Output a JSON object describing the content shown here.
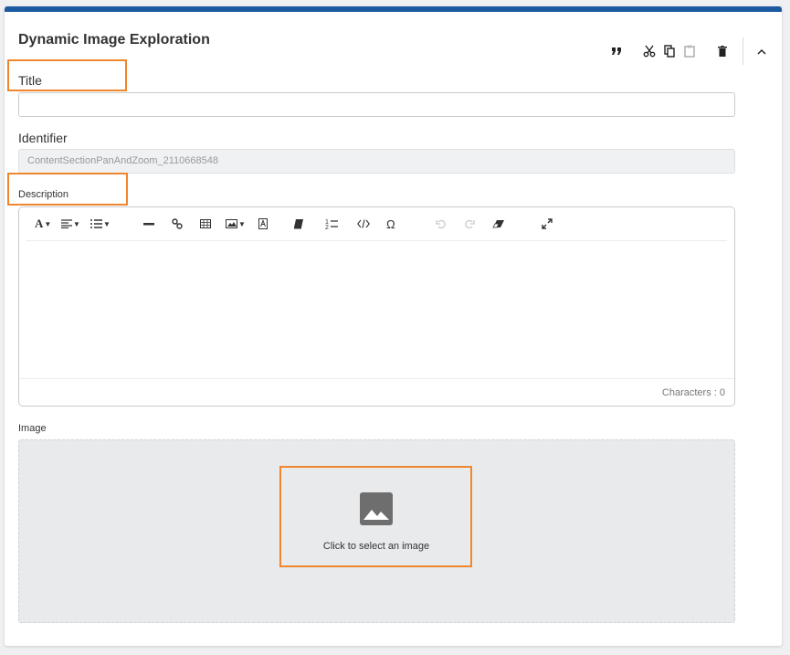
{
  "header": {
    "title": "Dynamic Image Exploration",
    "tools": [
      "quote-icon",
      "cut-icon",
      "copy-icon",
      "paste-icon",
      "delete-icon",
      "chevron-up-icon"
    ]
  },
  "form": {
    "title_label": "Title",
    "title_value": "",
    "identifier_label": "Identifier",
    "identifier_value": "ContentSectionPanAndZoom_2110668548",
    "description_label": "Description",
    "characters_label": "Characters : 0",
    "image_label": "Image",
    "image_prompt": "Click to select an image"
  },
  "editor_toolbar": [
    "font-icon",
    "align-icon",
    "list-icon",
    "horizontal-rule-icon",
    "link-icon",
    "table-icon",
    "image-icon",
    "text-box-icon",
    "book-icon",
    "numbered-step-icon",
    "code-icon",
    "omega-icon",
    "undo-icon",
    "redo-icon",
    "eraser-icon",
    "fullscreen-icon"
  ],
  "colors": {
    "accent": "#1b5aa0",
    "highlight": "#f0862e",
    "dropzone": "#e9eaec"
  }
}
